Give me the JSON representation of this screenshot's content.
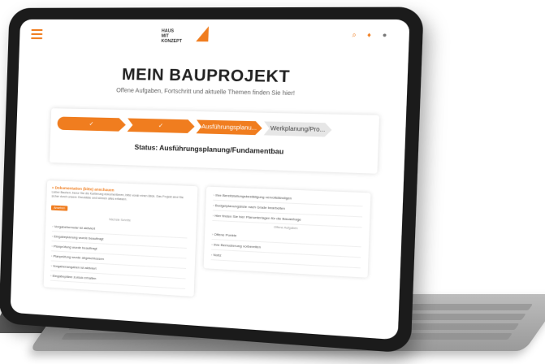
{
  "app": {
    "title": "MEIN BAUPROJEKT",
    "subtitle": "Offene Aufgaben, Fortschritt und aktuelle Themen finden Sie hier!"
  },
  "header": {
    "logo_text": "HAUS\nMIT\nKONZEPT",
    "icons": [
      "hamburger-icon",
      "search-icon",
      "bell-icon",
      "user-icon"
    ],
    "accent": "#f07d1f"
  },
  "progress": {
    "steps": [
      {
        "label": "✓",
        "state": "done"
      },
      {
        "label": "✓",
        "state": "done"
      },
      {
        "label": "Ausführungsplanu...",
        "state": "active"
      },
      {
        "label": "Werkplanung/Pro...",
        "state": "pending"
      }
    ],
    "status": "Status: Ausführungsplanung/Fundamentbau"
  },
  "left_card": {
    "warning_title": "» Dokumentation (bitte) anschauen",
    "warning_text": "Lieber Bauherr, bevor Sie die Kartierung dokumentieren, bitte vorab einen Blick. Das Projekt sind Sie sicher durch unsere Checkliste und können alles erfassen.",
    "button": "Ansehen",
    "section_label": "Nächste Schritte",
    "items": [
      "Vorgabeformular ist aktiviert",
      "Eingabeplanung wurde beauftragt",
      "Planprüfung wurde beauftragt",
      "Planprüfung wurde abgeschlossen",
      "Vorgabenangaben ist aktiviert",
      "Eingabepläne zurück erhalten"
    ]
  },
  "right_card": {
    "items": [
      "Ihre Bereitstellungsbestätigung vervollständigen",
      "Budgetplanungsliste nach Grade bearbeiten",
      "Hier finden Sie hier Planunterlagen für die Bauanfrage",
      "Offene Punkte",
      "Ihre Bemusterung vorbereiten",
      "Notiz"
    ],
    "section_label": "Offene Aufgaben"
  }
}
